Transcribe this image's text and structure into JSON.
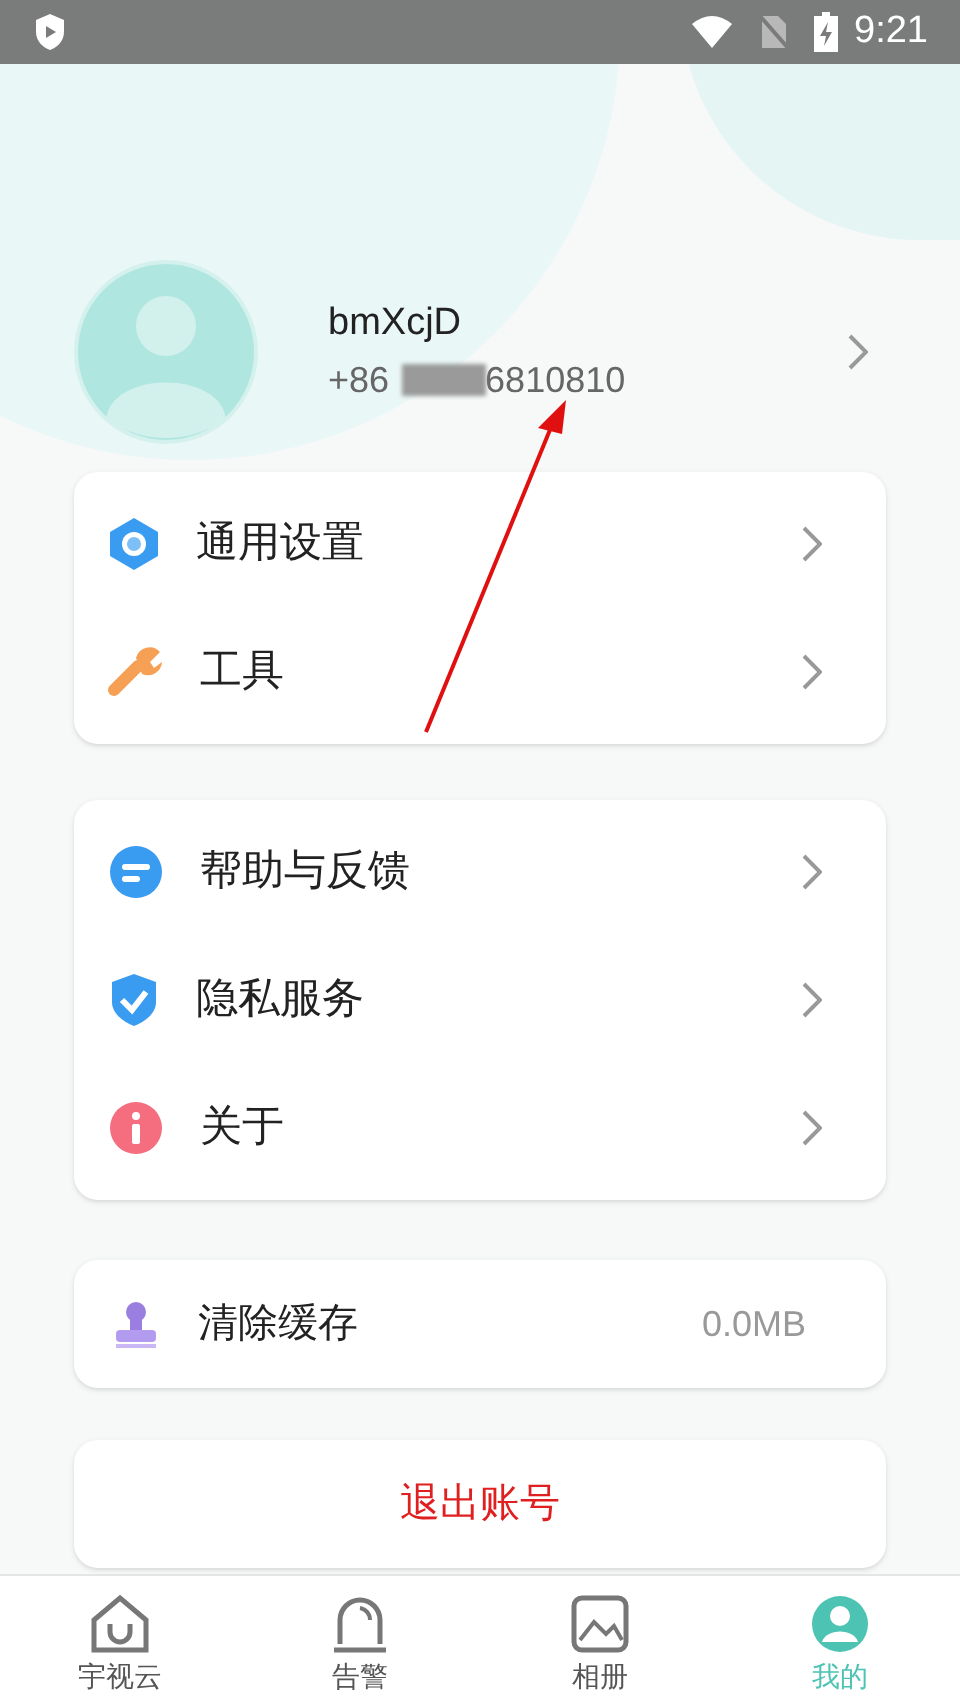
{
  "status_bar": {
    "time": "9:21"
  },
  "profile": {
    "name": "bmXcjD",
    "phone_prefix": "+86",
    "phone_suffix": "6810810"
  },
  "menu_groups": [
    {
      "items": [
        {
          "kind": "settings",
          "label": "通用设置"
        },
        {
          "kind": "tools",
          "label": "工具"
        }
      ]
    },
    {
      "items": [
        {
          "kind": "help",
          "label": "帮助与反馈"
        },
        {
          "kind": "privacy",
          "label": "隐私服务"
        },
        {
          "kind": "about",
          "label": "关于"
        }
      ]
    }
  ],
  "cache": {
    "label": "清除缓存",
    "value": "0.0MB"
  },
  "logout": {
    "label": "退出账号"
  },
  "bottom_nav": [
    {
      "kind": "home",
      "label": "宇视云",
      "selected": false
    },
    {
      "kind": "alarm",
      "label": "告警",
      "selected": false
    },
    {
      "kind": "album",
      "label": "相册",
      "selected": false
    },
    {
      "kind": "me",
      "label": "我的",
      "selected": true
    }
  ]
}
